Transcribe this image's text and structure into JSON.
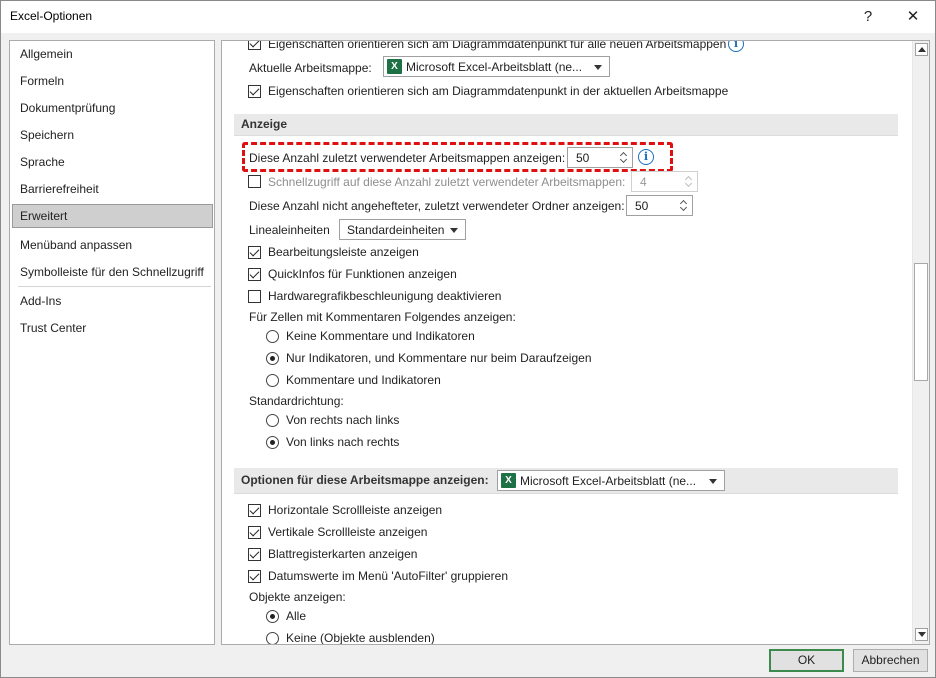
{
  "window": {
    "title": "Excel-Optionen",
    "help_glyph": "?",
    "close_glyph": "✕"
  },
  "sidebar": {
    "items": [
      {
        "label": "Allgemein"
      },
      {
        "label": "Formeln"
      },
      {
        "label": "Dokumentprüfung"
      },
      {
        "label": "Speichern"
      },
      {
        "label": "Sprache"
      },
      {
        "label": "Barrierefreiheit"
      },
      {
        "label": "Erweitert",
        "selected": true
      },
      {
        "label": "Menüband anpassen"
      },
      {
        "label": "Symbolleiste für den Schnellzugriff"
      },
      {
        "label": "Add-Ins"
      },
      {
        "label": "Trust Center"
      }
    ]
  },
  "content": {
    "top": {
      "cut_option": "Eigenschaften orientieren sich am Diagrammdatenpunkt für alle neuen Arbeitsmappen",
      "cut_option_checked": true,
      "workbook_label": "Aktuelle Arbeitsmappe:",
      "workbook_value": "Microsoft Excel-Arbeitsblatt (ne...",
      "current_option": "Eigenschaften orientieren sich am Diagrammdatenpunkt in der aktuellen Arbeitsmappe",
      "current_option_checked": true
    },
    "anzeige": {
      "heading": "Anzeige",
      "recent_label": "Diese Anzahl zuletzt verwendeter Arbeitsmappen anzeigen:",
      "recent_value": "50",
      "quick_access_label": "Schnellzugriff auf diese Anzahl zuletzt verwendeter Arbeitsmappen:",
      "quick_access_value": "4",
      "quick_access_checked": false,
      "folders_label": "Diese Anzahl nicht angehefteter, zuletzt verwendeter Ordner anzeigen:",
      "folders_value": "50",
      "ruler_label": "Linealeinheiten",
      "ruler_value": "Standardeinheiten",
      "formula_bar": "Bearbeitungsleiste anzeigen",
      "formula_bar_checked": true,
      "quickinfos": "QuickInfos für Funktionen anzeigen",
      "quickinfos_checked": true,
      "hw_accel": "Hardwaregrafikbeschleunigung deaktivieren",
      "hw_accel_checked": false,
      "comments_label": "Für Zellen mit Kommentaren Folgendes anzeigen:",
      "comments_options": [
        {
          "label": "Keine Kommentare und Indikatoren",
          "selected": false
        },
        {
          "label": "Nur Indikatoren, und Kommentare nur beim Daraufzeigen",
          "selected": true
        },
        {
          "label": "Kommentare und Indikatoren",
          "selected": false
        }
      ],
      "direction_label": "Standardrichtung:",
      "direction_options": [
        {
          "label": "Von rechts nach links",
          "selected": false
        },
        {
          "label": "Von links nach rechts",
          "selected": true
        }
      ]
    },
    "workbook_section": {
      "heading": "Optionen für diese Arbeitsmappe anzeigen:",
      "workbook_value": "Microsoft Excel-Arbeitsblatt (ne...",
      "options": [
        {
          "label": "Horizontale Scrollleiste anzeigen",
          "checked": true
        },
        {
          "label": "Vertikale Scrollleiste anzeigen",
          "checked": true
        },
        {
          "label": "Blattregisterkarten anzeigen",
          "checked": true
        },
        {
          "label": "Datumswerte im Menü 'AutoFilter' gruppieren",
          "checked": true
        }
      ],
      "objects_label": "Objekte anzeigen:",
      "objects_options": [
        {
          "label": "Alle",
          "selected": true
        },
        {
          "label": "Keine (Objekte ausblenden)",
          "selected": false
        }
      ]
    }
  },
  "footer": {
    "ok_label": "OK",
    "cancel_label": "Abbrechen"
  },
  "colors": {
    "highlight_border": "#e01010",
    "excel_green": "#1e7145",
    "info_blue": "#1a6fc4"
  }
}
